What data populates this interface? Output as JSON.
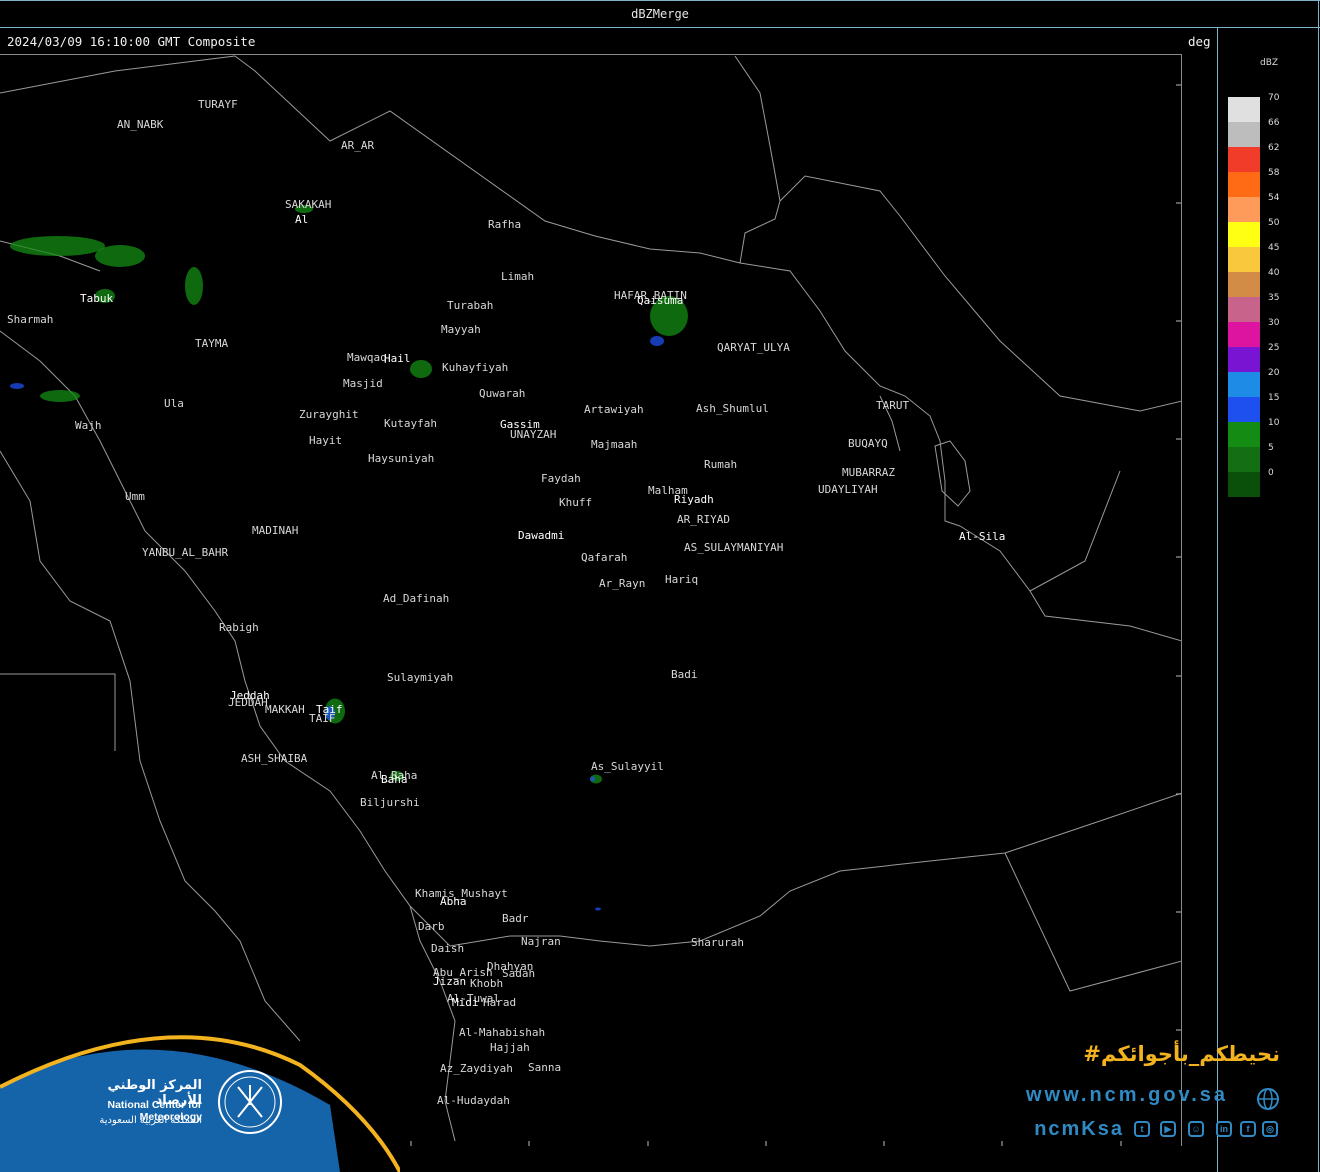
{
  "window": {
    "title": "dBZMerge"
  },
  "header": {
    "timestamp": "2024/03/09 16:10:00 GMT Composite",
    "unit": "deg"
  },
  "legend": {
    "unit": "dBZ",
    "entries": [
      {
        "value": "70",
        "color": "#e0e0e0"
      },
      {
        "value": "66",
        "color": "#bdbdbd"
      },
      {
        "value": "62",
        "color": "#f03c28"
      },
      {
        "value": "58",
        "color": "#ff6a14"
      },
      {
        "value": "54",
        "color": "#ff9b5a"
      },
      {
        "value": "50",
        "color": "#ffff14"
      },
      {
        "value": "45",
        "color": "#fac83c"
      },
      {
        "value": "40",
        "color": "#d28c46"
      },
      {
        "value": "35",
        "color": "#c8648c"
      },
      {
        "value": "30",
        "color": "#dc14a0"
      },
      {
        "value": "25",
        "color": "#7814d2"
      },
      {
        "value": "20",
        "color": "#1e8ce6"
      },
      {
        "value": "15",
        "color": "#1e50f0"
      },
      {
        "value": "10",
        "color": "#148c14"
      },
      {
        "value": "5",
        "color": "#146e14"
      },
      {
        "value": "0",
        "color": "#0a500a"
      }
    ]
  },
  "axes": {
    "lat_ticks": [
      "32",
      "30",
      "28",
      "26",
      "24",
      "22",
      "20",
      "18",
      "16"
    ],
    "lon_ticks": [
      "42",
      "44",
      "46",
      "48",
      "50",
      "52",
      "54"
    ]
  },
  "places": [
    {
      "name": "TURAYF"
    },
    {
      "name": "AN_NABK"
    },
    {
      "name": "AR_AR"
    },
    {
      "name": "SAKAKAH"
    },
    {
      "name": "Al"
    },
    {
      "name": "Rafha"
    },
    {
      "name": "Tabuk"
    },
    {
      "name": "Sharmah"
    },
    {
      "name": "TAYMA"
    },
    {
      "name": "Limah"
    },
    {
      "name": "Turabah"
    },
    {
      "name": "Mayyah"
    },
    {
      "name": "HAFAR_BATIN"
    },
    {
      "name": "Qaisuma"
    },
    {
      "name": "Mawqaq"
    },
    {
      "name": "Hail"
    },
    {
      "name": "Kuhayfiyah"
    },
    {
      "name": "QARYAT_ULYA"
    },
    {
      "name": "Masjid"
    },
    {
      "name": "Quwarah"
    },
    {
      "name": "Ula"
    },
    {
      "name": "Zurayghit"
    },
    {
      "name": "Artawiyah"
    },
    {
      "name": "Ash_Shumlul"
    },
    {
      "name": "TARUT"
    },
    {
      "name": "Wajh"
    },
    {
      "name": "Kutayfah"
    },
    {
      "name": "Gassim"
    },
    {
      "name": "UNAYZAH"
    },
    {
      "name": "Hayit"
    },
    {
      "name": "Majmaah"
    },
    {
      "name": "BUQAYQ"
    },
    {
      "name": "Haysuniyah"
    },
    {
      "name": "Rumah"
    },
    {
      "name": "MUBARRAZ"
    },
    {
      "name": "Faydah"
    },
    {
      "name": "Malham"
    },
    {
      "name": "UDAYLIYAH"
    },
    {
      "name": "Umm"
    },
    {
      "name": "Khuff"
    },
    {
      "name": "Riyadh"
    },
    {
      "name": "AR_RIYAD"
    },
    {
      "name": "MADINAH"
    },
    {
      "name": "Dawadmi"
    },
    {
      "name": "Al-Sila"
    },
    {
      "name": "AS_SULAYMANIYAH"
    },
    {
      "name": "YANBU_AL_BAHR"
    },
    {
      "name": "Qafarah"
    },
    {
      "name": "Ar_Rayn"
    },
    {
      "name": "Hariq"
    },
    {
      "name": "Ad_Dafinah"
    },
    {
      "name": "Rabigh"
    },
    {
      "name": "Sulaymiyah"
    },
    {
      "name": "Badi"
    },
    {
      "name": "Jeddah"
    },
    {
      "name": "JEDDAH"
    },
    {
      "name": "MAKKAH"
    },
    {
      "name": "Taif"
    },
    {
      "name": "TAIF"
    },
    {
      "name": "ASH_SHAIBA"
    },
    {
      "name": "As_Sulayyil"
    },
    {
      "name": "Al_Baha"
    },
    {
      "name": "Baha"
    },
    {
      "name": "Biljurshi"
    },
    {
      "name": "Khamis_Mushayt"
    },
    {
      "name": "Abha"
    },
    {
      "name": "Badr"
    },
    {
      "name": "Darb"
    },
    {
      "name": "Najran"
    },
    {
      "name": "Sharurah"
    },
    {
      "name": "Daish"
    },
    {
      "name": "Dhahyan"
    },
    {
      "name": "Abu_Arish"
    },
    {
      "name": "Sadah"
    },
    {
      "name": "Jizan"
    },
    {
      "name": "Khobh"
    },
    {
      "name": "Al-Tuwal"
    },
    {
      "name": "Midi"
    },
    {
      "name": "Harad"
    },
    {
      "name": "Al-Mahabishah"
    },
    {
      "name": "Hajjah"
    },
    {
      "name": "Az_Zaydiyah"
    },
    {
      "name": "Sanna"
    },
    {
      "name": "Al-Hudaydah"
    }
  ],
  "branding": {
    "org_ar": "المركز الوطني للأرصاد",
    "org_en": "National Center for Meteorology",
    "country_ar": "المملكة العربية السعودية",
    "hashtag": "#نحيطكم_بأجوائكم",
    "website": "www.ncm.gov.sa",
    "handle": "ncmKsa",
    "social_icons": [
      "twitter-icon",
      "youtube-icon",
      "snapchat-icon",
      "linkedin-icon",
      "facebook-icon",
      "instagram-icon"
    ]
  }
}
